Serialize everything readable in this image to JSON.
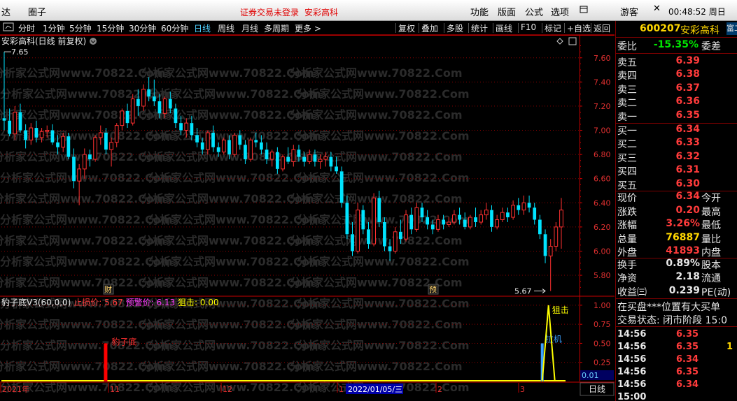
{
  "topbar": {
    "title_left": "达",
    "menu_quanzi": "圈子",
    "notice": "证券交易未登录",
    "stock_name": "安彩高科",
    "menu_function": "功能",
    "menu_layout": "版面",
    "menu_formula": "公式",
    "menu_options": "选项",
    "menu_extra": "",
    "user": "游客",
    "time": "00:48:52 周日"
  },
  "toolbar": {
    "left": [
      "分时",
      "1分钟",
      "5分钟",
      "15分钟",
      "30分钟",
      "60分钟",
      "日线",
      "周线",
      "月线",
      "多周期",
      "更多 >"
    ],
    "active": "日线",
    "right": [
      "复权",
      "叠加",
      "多股",
      "统计",
      "画线",
      "F10",
      "标记",
      "+自选",
      "返回"
    ]
  },
  "main_chart": {
    "title": "安彩高科(日线 前复权)",
    "annotation_high": "7.65",
    "annotation_low": "5.67",
    "marker_cai": "财",
    "marker_yu": "预",
    "watermark": "分析家公式网www.70822.Com",
    "colors": {
      "up": "#ff3030",
      "down": "#00e4ff",
      "grid": "#8b0000",
      "axis": "#c80000"
    }
  },
  "indicator": {
    "name": "豹子底V3(60,0,0)",
    "stop_label": "止损价:",
    "stop_value": "5.67",
    "warn_label": "预警价:",
    "warn_value": "6.13",
    "snipe_label": "狙击:",
    "snipe_value": "0.00",
    "bar_label": "豹子底",
    "line_label": "狙击",
    "blue_label": "拉机",
    "current_value": "0.01",
    "period_label": "日线",
    "colors": {
      "stop": "#ff3b3b",
      "warn": "#ff3bff",
      "snipe": "#ffff00"
    }
  },
  "axis": {
    "price_ticks": [
      "7.60",
      "7.40",
      "7.20",
      "7.00",
      "6.80",
      "6.60",
      "6.40",
      "6.20",
      "6.00",
      "5.80"
    ],
    "ind_ticks": [
      "1.00",
      "0.75",
      "0.50",
      "0.25"
    ],
    "date_labels": [
      "2021年",
      "11",
      "12",
      "1",
      "2022/01/05/三",
      "2",
      "3"
    ]
  },
  "chart_data": {
    "type": "candlestick",
    "title": "安彩高科(日线 前复权)",
    "ylim": [
      5.65,
      7.72
    ],
    "candles": [
      [
        7.1,
        7.65,
        7.0,
        7.08
      ],
      [
        7.08,
        7.18,
        6.95,
        6.97
      ],
      [
        6.97,
        7.2,
        6.92,
        7.15
      ],
      [
        7.15,
        7.22,
        6.98,
        7.0
      ],
      [
        7.0,
        7.05,
        6.85,
        6.92
      ],
      [
        6.92,
        7.06,
        6.88,
        7.02
      ],
      [
        7.02,
        7.08,
        6.9,
        6.94
      ],
      [
        6.94,
        7.02,
        6.9,
        6.99
      ],
      [
        6.99,
        7.04,
        6.94,
        7.0
      ],
      [
        7.0,
        7.05,
        6.88,
        6.9
      ],
      [
        6.9,
        6.96,
        6.8,
        6.86
      ],
      [
        6.86,
        6.98,
        6.82,
        6.95
      ],
      [
        6.95,
        6.98,
        6.76,
        6.78
      ],
      [
        6.78,
        6.85,
        6.52,
        6.58
      ],
      [
        6.58,
        6.72,
        6.38,
        6.68
      ],
      [
        6.68,
        6.85,
        6.6,
        6.8
      ],
      [
        6.8,
        6.84,
        6.7,
        6.76
      ],
      [
        6.76,
        6.96,
        6.74,
        6.94
      ],
      [
        6.94,
        7.04,
        6.88,
        6.98
      ],
      [
        6.98,
        7.02,
        6.8,
        6.84
      ],
      [
        6.84,
        6.94,
        6.7,
        6.9
      ],
      [
        6.9,
        7.06,
        6.86,
        7.04
      ],
      [
        7.04,
        7.18,
        7.0,
        7.16
      ],
      [
        7.16,
        7.22,
        7.02,
        7.06
      ],
      [
        7.06,
        7.3,
        7.04,
        7.26
      ],
      [
        7.26,
        7.34,
        7.12,
        7.2
      ],
      [
        7.2,
        7.38,
        7.16,
        7.34
      ],
      [
        7.34,
        7.44,
        7.24,
        7.28
      ],
      [
        7.28,
        7.42,
        7.2,
        7.24
      ],
      [
        7.24,
        7.3,
        7.1,
        7.14
      ],
      [
        7.14,
        7.28,
        7.1,
        7.26
      ],
      [
        7.26,
        7.32,
        7.14,
        7.18
      ],
      [
        7.18,
        7.22,
        7.02,
        7.06
      ],
      [
        7.06,
        7.12,
        6.96,
        7.0
      ],
      [
        7.0,
        7.1,
        6.94,
        7.06
      ],
      [
        7.06,
        7.12,
        6.92,
        6.96
      ],
      [
        6.96,
        7.02,
        6.86,
        6.9
      ],
      [
        6.9,
        6.94,
        6.8,
        6.84
      ],
      [
        6.84,
        7.0,
        6.8,
        6.98
      ],
      [
        6.98,
        7.04,
        6.82,
        6.86
      ],
      [
        6.86,
        6.9,
        6.78,
        6.82
      ],
      [
        6.82,
        6.94,
        6.8,
        6.92
      ],
      [
        6.92,
        6.96,
        6.76,
        6.8
      ],
      [
        6.8,
        6.98,
        6.78,
        6.96
      ],
      [
        6.96,
        7.0,
        6.84,
        6.88
      ],
      [
        6.88,
        6.92,
        6.72,
        6.76
      ],
      [
        6.76,
        6.94,
        6.74,
        6.92
      ],
      [
        6.92,
        6.98,
        6.86,
        6.9
      ],
      [
        6.9,
        6.96,
        6.8,
        6.84
      ],
      [
        6.84,
        6.9,
        6.72,
        6.76
      ],
      [
        6.76,
        6.84,
        6.7,
        6.82
      ],
      [
        6.82,
        6.86,
        6.64,
        6.68
      ],
      [
        6.68,
        6.8,
        6.66,
        6.78
      ],
      [
        6.78,
        6.86,
        6.72,
        6.74
      ],
      [
        6.74,
        6.88,
        6.7,
        6.84
      ],
      [
        6.84,
        6.88,
        6.74,
        6.78
      ],
      [
        6.78,
        6.82,
        6.7,
        6.74
      ],
      [
        6.74,
        6.84,
        6.72,
        6.8
      ],
      [
        6.8,
        6.84,
        6.7,
        6.74
      ],
      [
        6.74,
        6.8,
        6.68,
        6.76
      ],
      [
        6.76,
        6.82,
        6.7,
        6.78
      ],
      [
        6.78,
        6.82,
        6.66,
        6.7
      ],
      [
        6.7,
        6.78,
        6.64,
        6.66
      ],
      [
        6.66,
        6.7,
        6.36,
        6.4
      ],
      [
        6.4,
        6.46,
        6.1,
        6.14
      ],
      [
        6.14,
        6.24,
        5.96,
        6.0
      ],
      [
        6.0,
        6.4,
        5.98,
        6.34
      ],
      [
        6.34,
        6.38,
        6.14,
        6.18
      ],
      [
        6.18,
        6.24,
        6.02,
        6.06
      ],
      [
        6.06,
        6.48,
        6.04,
        6.44
      ],
      [
        6.44,
        6.5,
        6.2,
        6.24
      ],
      [
        6.24,
        6.28,
        6.0,
        6.04
      ],
      [
        6.04,
        6.1,
        5.92,
        6.0
      ],
      [
        6.0,
        6.2,
        5.98,
        6.16
      ],
      [
        6.16,
        6.26,
        6.06,
        6.1
      ],
      [
        6.1,
        6.34,
        6.08,
        6.3
      ],
      [
        6.3,
        6.36,
        6.14,
        6.18
      ],
      [
        6.18,
        6.4,
        6.16,
        6.36
      ],
      [
        6.36,
        6.4,
        6.24,
        6.28
      ],
      [
        6.28,
        6.34,
        6.18,
        6.22
      ],
      [
        6.22,
        6.26,
        6.14,
        6.18
      ],
      [
        6.18,
        6.3,
        6.16,
        6.26
      ],
      [
        6.26,
        6.3,
        6.18,
        6.22
      ],
      [
        6.22,
        6.28,
        6.2,
        6.24
      ],
      [
        6.24,
        6.34,
        6.22,
        6.3
      ],
      [
        6.3,
        6.36,
        6.22,
        6.26
      ],
      [
        6.26,
        6.32,
        6.18,
        6.2
      ],
      [
        6.2,
        6.3,
        6.18,
        6.28
      ],
      [
        6.28,
        6.36,
        6.2,
        6.24
      ],
      [
        6.24,
        6.34,
        6.22,
        6.3
      ],
      [
        6.3,
        6.4,
        6.26,
        6.34
      ],
      [
        6.34,
        6.38,
        6.16,
        6.2
      ],
      [
        6.2,
        6.3,
        6.18,
        6.26
      ],
      [
        6.26,
        6.36,
        6.24,
        6.32
      ],
      [
        6.32,
        6.36,
        6.24,
        6.28
      ],
      [
        6.28,
        6.42,
        6.26,
        6.38
      ],
      [
        6.38,
        6.44,
        6.3,
        6.34
      ],
      [
        6.34,
        6.46,
        6.3,
        6.4
      ],
      [
        6.4,
        6.46,
        6.32,
        6.36
      ],
      [
        6.36,
        6.4,
        6.22,
        6.26
      ],
      [
        6.26,
        6.3,
        6.1,
        6.14
      ],
      [
        6.14,
        6.18,
        5.9,
        5.96
      ],
      [
        5.96,
        6.1,
        5.67,
        6.04
      ],
      [
        6.04,
        6.24,
        6.0,
        6.2
      ],
      [
        6.2,
        6.44,
        6.02,
        6.34
      ]
    ],
    "indicator": {
      "stop_price": 5.67,
      "warn_price": 6.13,
      "snipe": 0.0,
      "ylim": [
        0,
        1.1
      ],
      "signal_bar": {
        "index": 19,
        "value": 0.5
      },
      "snipe_line": {
        "start_index": 102,
        "values": [
          0,
          1.0,
          0.01
        ]
      },
      "blue_bar": {
        "index": 102,
        "value": 0.5
      }
    }
  },
  "quote": {
    "code": "600207",
    "name": "安彩高科",
    "tab": "富二",
    "weibi_label": "委比",
    "weibi_value": "-15.35%",
    "weicha_label": "委差",
    "sells": [
      {
        "label": "卖五",
        "price": "6.39"
      },
      {
        "label": "卖四",
        "price": "6.38"
      },
      {
        "label": "卖三",
        "price": "6.37"
      },
      {
        "label": "卖二",
        "price": "6.36"
      },
      {
        "label": "卖一",
        "price": "6.35"
      }
    ],
    "buys": [
      {
        "label": "买一",
        "price": "6.34"
      },
      {
        "label": "买二",
        "price": "6.33"
      },
      {
        "label": "买三",
        "price": "6.32"
      },
      {
        "label": "买四",
        "price": "6.31"
      },
      {
        "label": "买五",
        "price": "6.30"
      }
    ],
    "stats": [
      {
        "label": "现价",
        "value": "6.34",
        "right": "今开",
        "color": "#ff3b3b"
      },
      {
        "label": "涨跌",
        "value": "0.20",
        "right": "最高",
        "color": "#ff3b3b"
      },
      {
        "label": "涨幅",
        "value": "3.26%",
        "right": "最低",
        "color": "#ff3b3b"
      },
      {
        "label": "总量",
        "value": "76887",
        "right": "量比",
        "color": "#ffd700"
      },
      {
        "label": "外盘",
        "value": "41893",
        "right": "内盘",
        "color": "#ff3b3b"
      }
    ],
    "stats2": [
      {
        "label": "换手",
        "value": "0.89%",
        "right": "股本"
      },
      {
        "label": "净资",
        "value": "2.18",
        "right": "流通"
      },
      {
        "label": "收益㈢",
        "value": "0.239",
        "right": "PE(动)"
      }
    ],
    "note1": "在买盘***位置有大买单",
    "note2": "交易状态: 闭市阶段 15:0",
    "ticks": [
      {
        "time": "14:56",
        "price": "6.35",
        "vol": ""
      },
      {
        "time": "14:56",
        "price": "6.35",
        "vol": "1"
      },
      {
        "time": "14:56",
        "price": "6.34",
        "vol": ""
      },
      {
        "time": "14:56",
        "price": "6.35",
        "vol": ""
      },
      {
        "time": "14:56",
        "price": "6.34",
        "vol": ""
      },
      {
        "time": "15:00",
        "price": "",
        "vol": ""
      }
    ]
  }
}
